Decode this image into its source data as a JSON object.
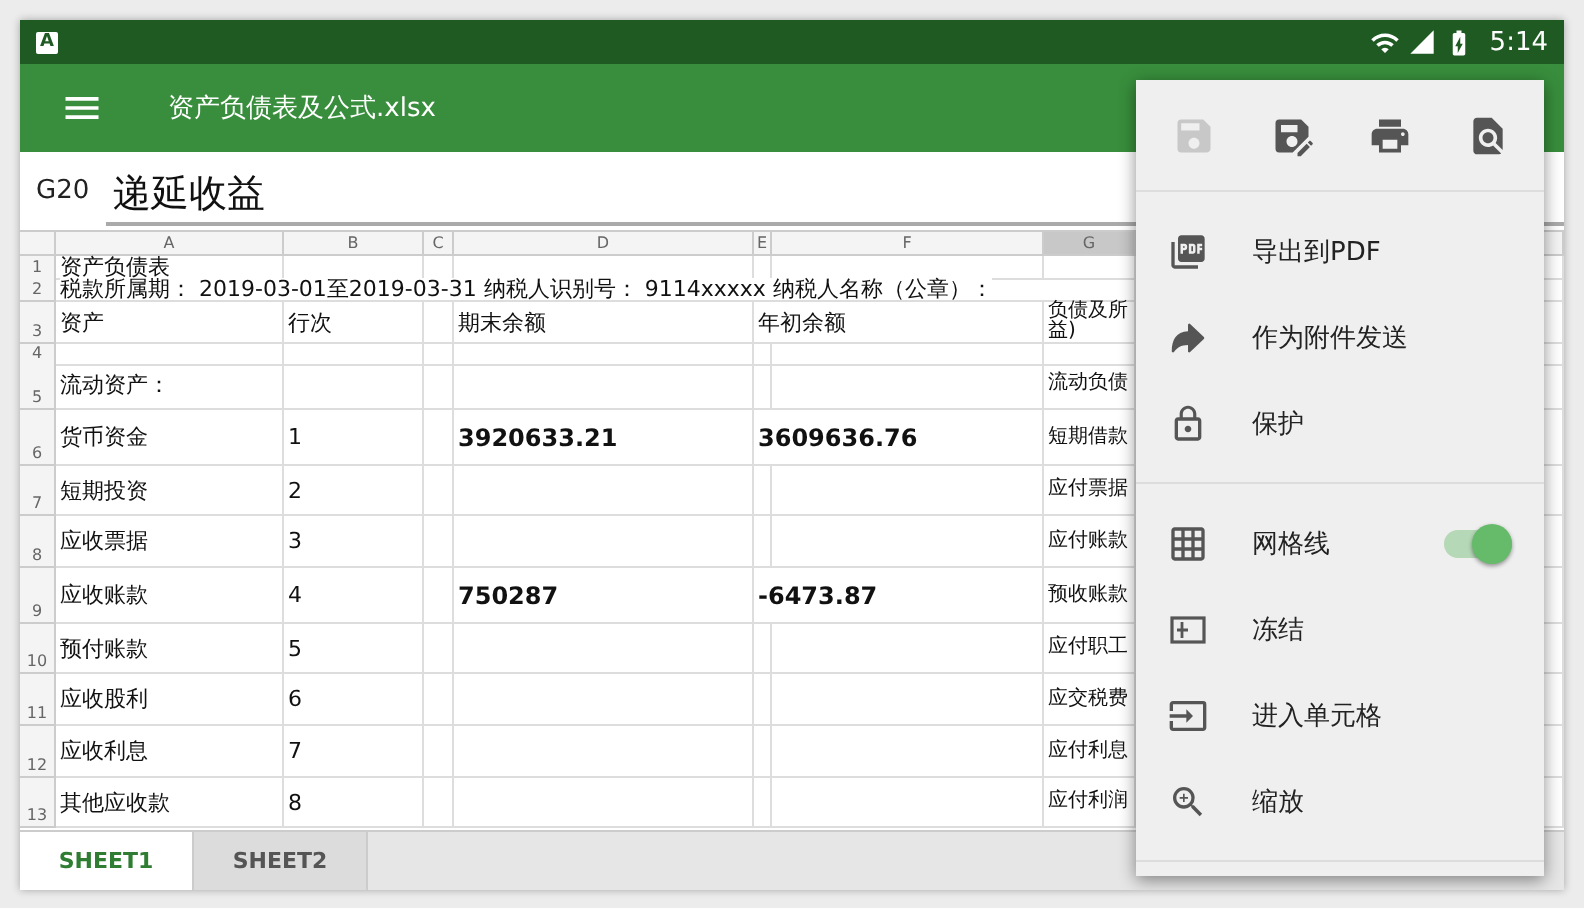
{
  "status_bar": {
    "app_badge": "A",
    "time": "5:14"
  },
  "toolbar": {
    "title": "资产负债表及公式.xlsx"
  },
  "formula_bar": {
    "cell": "G20",
    "value": "递延收益"
  },
  "sheet": {
    "columns": [
      {
        "label": "A",
        "selected": false
      },
      {
        "label": "B",
        "selected": false
      },
      {
        "label": "C",
        "selected": false
      },
      {
        "label": "D",
        "selected": false
      },
      {
        "label": "E",
        "selected": false
      },
      {
        "label": "F",
        "selected": false
      },
      {
        "label": "G",
        "selected": true
      }
    ],
    "rows": [
      {
        "number": "1",
        "cells": [
          "资产负债表",
          "",
          "",
          "",
          "",
          "",
          ""
        ]
      },
      {
        "number": "2",
        "cells": [
          "税款所属期： 2019-03-01至2019-03-31 纳税人识别号： 9114xxxxx 纳税人名称（公章）：",
          "",
          "",
          "",
          "",
          "",
          ""
        ]
      },
      {
        "number": "3",
        "cells": [
          "资产",
          "行次",
          "",
          "期末余额",
          "年初余额",
          "",
          "负债及所益)"
        ]
      },
      {
        "number": "4",
        "cells": [
          "",
          "",
          "",
          "",
          "",
          "",
          ""
        ]
      },
      {
        "number": "5",
        "cells": [
          "流动资产：",
          "",
          "",
          "",
          "",
          "",
          "流动负债"
        ]
      },
      {
        "number": "6",
        "cells": [
          "货币资金",
          "1",
          "",
          {
            "text": "3920633.21",
            "bold": true
          },
          {
            "text": "3609636.76",
            "bold": true
          },
          "",
          "短期借款"
        ]
      },
      {
        "number": "7",
        "cells": [
          "短期投资",
          "2",
          "",
          "",
          "",
          "",
          "应付票据"
        ]
      },
      {
        "number": "8",
        "cells": [
          "应收票据",
          "3",
          "",
          "",
          "",
          "",
          "应付账款"
        ]
      },
      {
        "number": "9",
        "cells": [
          "应收账款",
          "4",
          "",
          {
            "text": "750287",
            "bold": true
          },
          {
            "text": "-6473.87",
            "bold": true
          },
          "",
          "预收账款"
        ]
      },
      {
        "number": "10",
        "cells": [
          "预付账款",
          "5",
          "",
          "",
          "",
          "",
          "应付职工"
        ]
      },
      {
        "number": "11",
        "cells": [
          "应收股利",
          "6",
          "",
          "",
          "",
          "",
          "应交税费"
        ]
      },
      {
        "number": "12",
        "cells": [
          "应收利息",
          "7",
          "",
          "",
          "",
          "",
          "应付利息"
        ]
      },
      {
        "number": "13",
        "cells": [
          "其他应收款",
          "8",
          "",
          "",
          "",
          "",
          "应付利润"
        ]
      }
    ]
  },
  "menu": {
    "actions": [
      {
        "kind": "save",
        "disabled": true
      },
      {
        "kind": "save_as",
        "disabled": false
      },
      {
        "kind": "print",
        "disabled": false
      },
      {
        "kind": "preview",
        "disabled": false
      }
    ],
    "groups": [
      [
        {
          "kind": "pdf",
          "label": "导出到PDF"
        },
        {
          "kind": "send",
          "label": "作为附件发送"
        },
        {
          "kind": "lock",
          "label": "保护"
        }
      ],
      [
        {
          "kind": "grid",
          "label": "网格线",
          "on": true
        },
        {
          "kind": "freeze",
          "label": "冻结"
        },
        {
          "kind": "enter",
          "label": "进入单元格"
        },
        {
          "kind": "zoom",
          "label": "缩放"
        }
      ]
    ]
  },
  "sheet_tabs": [
    {
      "label": "SHEET1",
      "selected": true
    },
    {
      "label": "SHEET2",
      "selected": false
    }
  ]
}
